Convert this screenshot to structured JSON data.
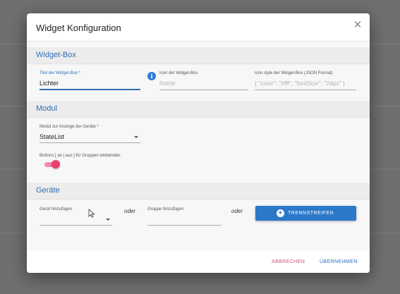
{
  "dialog": {
    "title": "Widget Konfiguration",
    "close_icon": "close-icon"
  },
  "sections": {
    "widget_box": "Widget-Box",
    "modul": "Modul",
    "geraete": "Geräte"
  },
  "widget_box": {
    "title_field": {
      "label": "Titel der Widget-Box *",
      "value": "Lichter"
    },
    "icon_field": {
      "label": "Icon der Widget-Box",
      "placeholder": "home"
    },
    "icon_style_field": {
      "label": "Icon style der Widget-Box (JSON Format)",
      "placeholder": "{ \"color\": \"#fff\", \"fontSize\": \"24px\" }"
    },
    "info_icon": "i"
  },
  "modul": {
    "select": {
      "label": "Modul zur Anzeige der Geräte *",
      "value": "StateList"
    },
    "toggle": {
      "label": "Buttons [ an | aus ] für Gruppen einblenden",
      "checked": true
    }
  },
  "geraete": {
    "device_select": {
      "label": "Gerät hinzufügen",
      "value": ""
    },
    "oder_1": "oder",
    "group_field": {
      "label": "Gruppe hinzufügen",
      "value": ""
    },
    "oder_2": "oder",
    "button_label": "TRENNSTREIFEN"
  },
  "footer": {
    "cancel": "ABBRECHEN",
    "apply": "ÜBERNEHMEN"
  },
  "colors": {
    "accent": "#2f6fb4",
    "toggle": "#ec3f6e",
    "cancel": "#d0526f",
    "primary_button": "#2b78c8"
  }
}
